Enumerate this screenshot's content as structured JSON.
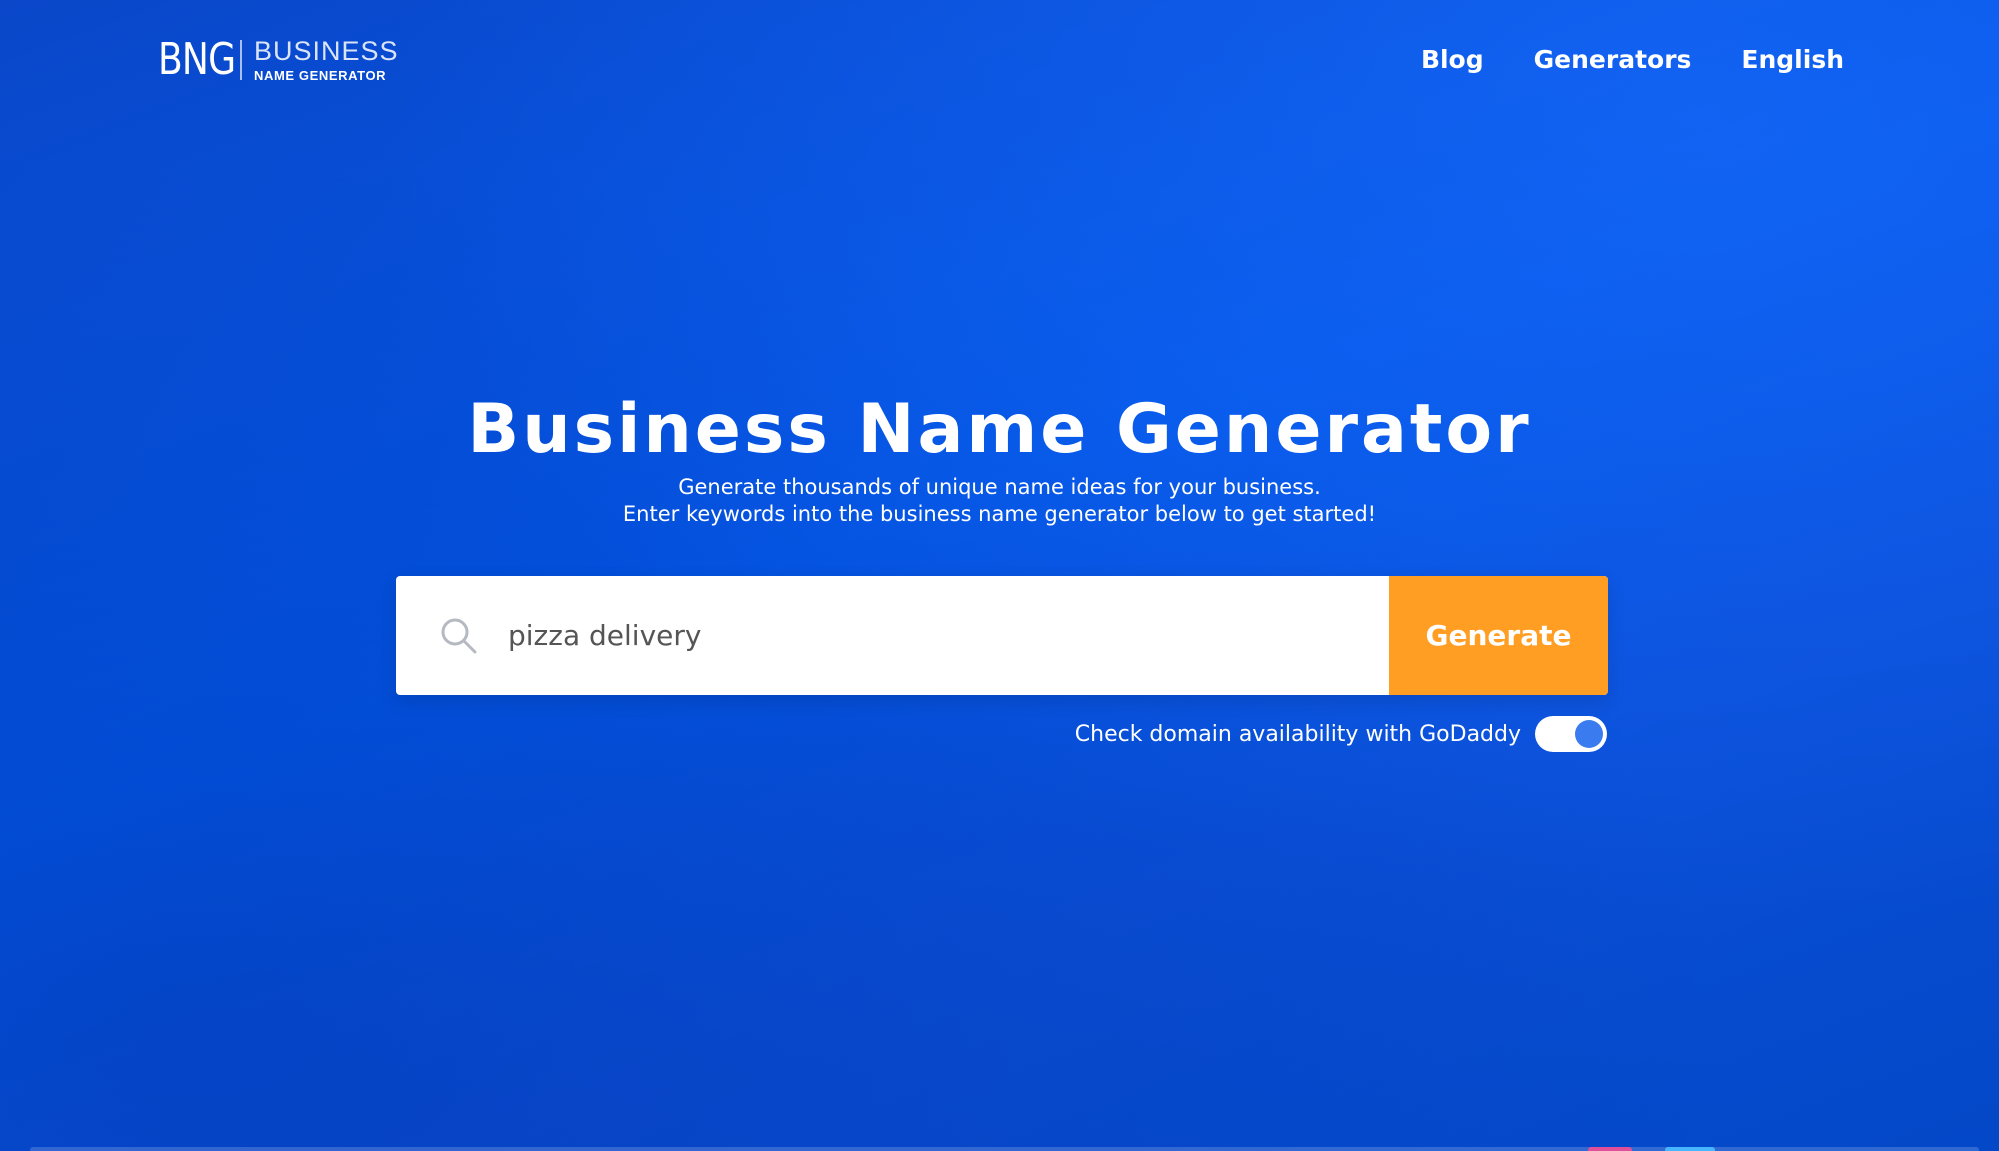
{
  "header": {
    "logo": {
      "mark": "BNG",
      "top": "BUSINESS",
      "bottom": "NAME GENERATOR"
    },
    "nav": [
      {
        "label": "Blog"
      },
      {
        "label": "Generators"
      },
      {
        "label": "English"
      }
    ]
  },
  "hero": {
    "title": "Business Name Generator",
    "subtitle_line1": "Generate thousands of unique name ideas for your business.",
    "subtitle_line2": "Enter keywords into the business name generator below to get started!"
  },
  "search": {
    "value": "pizza delivery",
    "icon": "search-icon",
    "button_label": "Generate"
  },
  "domain_check": {
    "label": "Check domain availability with GoDaddy",
    "enabled": true
  },
  "colors": {
    "background": "#0357e8",
    "accent": "#ff9e22",
    "toggle_knob": "#3a7bf0"
  }
}
